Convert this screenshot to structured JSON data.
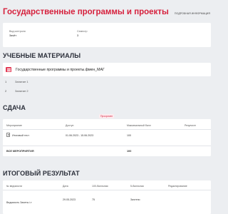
{
  "header": {
    "title": "Государственные программы и проекты",
    "details_link": "ПОДРОБНАЯ ИНФОРМАЦИЯ"
  },
  "info": {
    "control_label": "Вид контроля",
    "control_value": "Зачёт",
    "semester_label": "Семестр",
    "semester_value": "3"
  },
  "materials": {
    "heading": "УЧЕБНЫЕ МАТЕРИАЛЫ",
    "course_title": "Государственные программы и проекты.фмен_МАГ",
    "lessons": [
      {
        "num": "1",
        "title": "Занятие 1"
      },
      {
        "num": "2",
        "title": "Занятие 2"
      }
    ]
  },
  "submission": {
    "heading": "СДАЧА",
    "deadline_badge": "Просрочен",
    "columns": {
      "event": "Мероприятие",
      "access": "Доступ",
      "max_score": "Максимальный балл",
      "result": "Результат"
    },
    "row": {
      "event": "Итоговый тест",
      "access": "01.06.2023 - 15.06.2023",
      "max_score": "100",
      "result": ""
    },
    "total_label": "ВСЕ МЕРОПРИЯТИЯ",
    "total_value": "100"
  },
  "final_result": {
    "heading": "ИТОГОВЫЙ РЕЗУЛЬТАТ",
    "columns": {
      "statement": "№ ведомости",
      "date": "Дата",
      "score_100": "100-балльная",
      "score_5": "5-балльная",
      "editing": "Редактирование"
    },
    "row": {
      "statement": "Ведомость Зачеты і.т",
      "date": "29.05.2023",
      "score_100": "75",
      "score_5": "Зачтено",
      "editing": ""
    }
  },
  "colors": {
    "accent": "#d6213d",
    "background": "#eceef1",
    "card": "#ffffff"
  }
}
